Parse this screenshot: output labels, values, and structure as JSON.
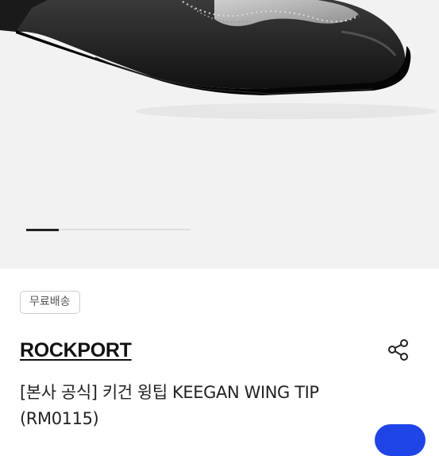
{
  "product": {
    "image_icon": "dress-shoe-photo",
    "gallery": {
      "current_slide": 1,
      "total_slides": 5
    },
    "badge": "무료배송",
    "brand": "ROCKPORT",
    "title": "[본사 공식] 키건 윙팁 KEEGAN WING TIP (RM0115)",
    "share_icon": "share-icon"
  },
  "colors": {
    "gallery_bg": "#f2f2f2",
    "accent": "#2045e6",
    "text": "#222222"
  }
}
